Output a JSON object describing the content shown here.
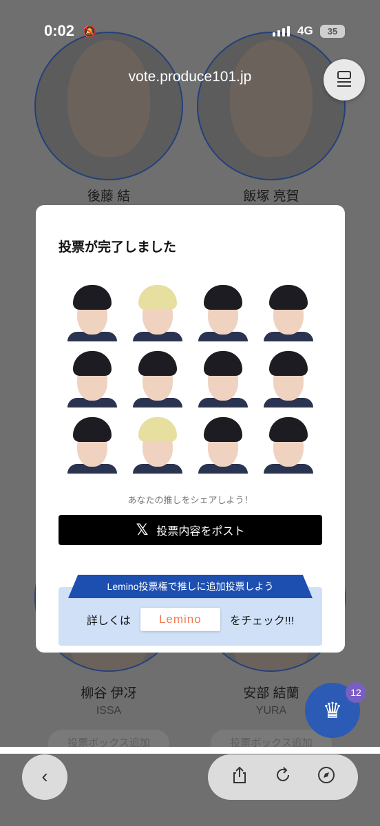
{
  "status_bar": {
    "time": "0:02",
    "network": "4G",
    "battery": "35"
  },
  "browser": {
    "url": "vote.produce101.jp"
  },
  "background_page": {
    "top_names": [
      "後藤 結",
      "飯塚 亮賀"
    ],
    "bottom_names": [
      "柳谷 伊冴",
      "安部 結蘭"
    ],
    "bottom_romaji": [
      "ISSA",
      "YURA"
    ],
    "add_button_label": "投票ボックス追加"
  },
  "modal": {
    "title": "投票が完了しました",
    "share_note": "あなたの推しをシェアしよう！",
    "post_button_label": "投票内容をポスト",
    "lemino_banner": "Lemino投票権で推しに追加投票しよう",
    "lemino_prefix": "詳しくは",
    "lemino_logo": "Lemino",
    "lemino_suffix": "をチェック!!!"
  },
  "vote_box": {
    "count": "12"
  }
}
